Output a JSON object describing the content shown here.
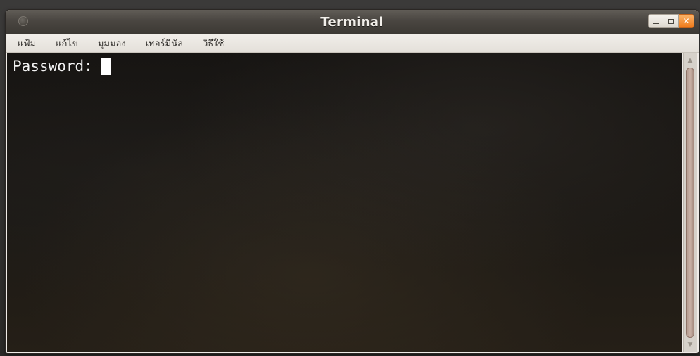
{
  "window": {
    "title": "Terminal"
  },
  "menubar": {
    "items": [
      {
        "label": "แฟ้ม"
      },
      {
        "label": "แก้ไข"
      },
      {
        "label": "มุมมอง"
      },
      {
        "label": "เทอร์มินัล"
      },
      {
        "label": "วิธีใช้"
      }
    ]
  },
  "terminal": {
    "prompt": "Password:"
  },
  "icons": {
    "window_menu": "circle-icon",
    "minimize": "minimize-icon",
    "maximize": "maximize-icon",
    "close": "close-icon",
    "scroll_up": "arrow-up-icon",
    "scroll_down": "arrow-down-icon"
  },
  "colors": {
    "titlebar": "#4a4641",
    "close_button": "#f07a1a",
    "terminal_bg": "#1a1714",
    "terminal_text": "#f2f2f2"
  }
}
